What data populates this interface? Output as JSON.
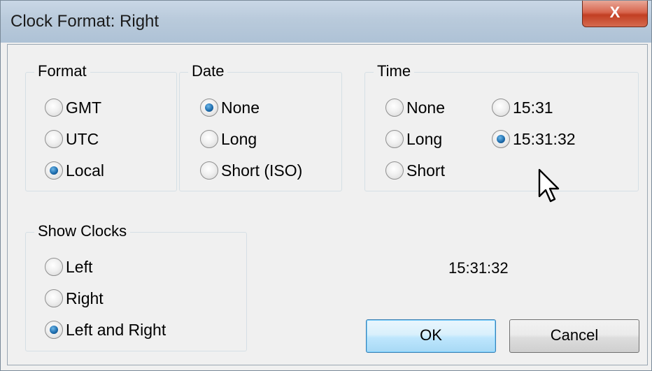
{
  "window": {
    "title": "Clock Format: Right",
    "close_label": "X"
  },
  "format": {
    "label": "Format",
    "options": [
      "GMT",
      "UTC",
      "Local"
    ],
    "selected": "Local"
  },
  "date": {
    "label": "Date",
    "options": [
      "None",
      "Long",
      "Short (ISO)"
    ],
    "selected": "None"
  },
  "time": {
    "label": "Time",
    "options": [
      "None",
      "Long",
      "Short",
      "15:31",
      "15:31:32"
    ],
    "selected": "15:31:32"
  },
  "show_clocks": {
    "label": "Show Clocks",
    "options": [
      "Left",
      "Right",
      "Left and Right"
    ],
    "selected": "Left and Right"
  },
  "preview": "15:31:32",
  "buttons": {
    "ok": "OK",
    "cancel": "Cancel"
  },
  "icons": {
    "close": "close-icon",
    "cursor": "mouse-pointer-icon"
  }
}
